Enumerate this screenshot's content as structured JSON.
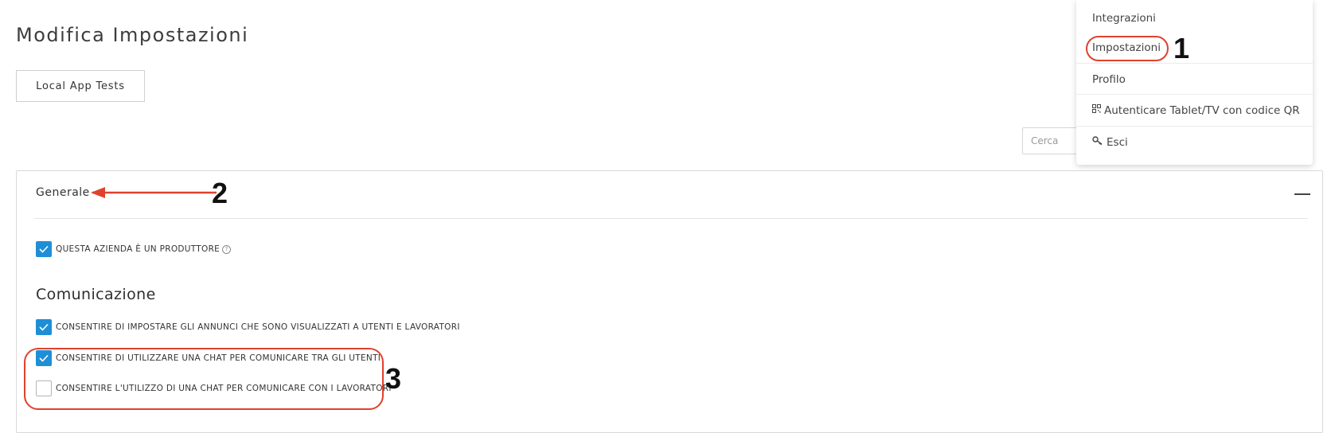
{
  "page": {
    "title": "Modifica Impostazioni"
  },
  "toolbar": {
    "app_button_label": "Local App Tests"
  },
  "search": {
    "placeholder": "Cerca"
  },
  "panel": {
    "title": "Generale",
    "producer_checkbox": {
      "label": "QUESTA AZIENDA È UN PRODUTTORE",
      "checked": true,
      "help_icon": "question-circle-icon"
    },
    "section_title": "Comunicazione",
    "options": [
      {
        "label": "CONSENTIRE DI IMPOSTARE GLI ANNUNCI CHE SONO VISUALIZZATI A UTENTI E LAVORATORI",
        "checked": true
      },
      {
        "label": "CONSENTIRE DI UTILIZZARE UNA CHAT PER COMUNICARE TRA GLI UTENTI",
        "checked": true
      },
      {
        "label": "CONSENTIRE L'UTILIZZO DI UNA CHAT PER COMUNICARE CON I LAVORATORI",
        "checked": false
      }
    ]
  },
  "menu": {
    "items": [
      {
        "label": "Integrazioni",
        "icon": ""
      },
      {
        "label": "Impostazioni",
        "icon": ""
      },
      {
        "label": "Profilo",
        "icon": ""
      },
      {
        "label": "Autenticare Tablet/TV con codice QR",
        "icon": "qr-code-icon"
      },
      {
        "label": "Esci",
        "icon": "key-icon"
      }
    ]
  },
  "annotations": {
    "step1": "1",
    "step2": "2",
    "step3": "3"
  },
  "colors": {
    "accent": "#1e8fd6",
    "annotation": "#e0412d"
  }
}
